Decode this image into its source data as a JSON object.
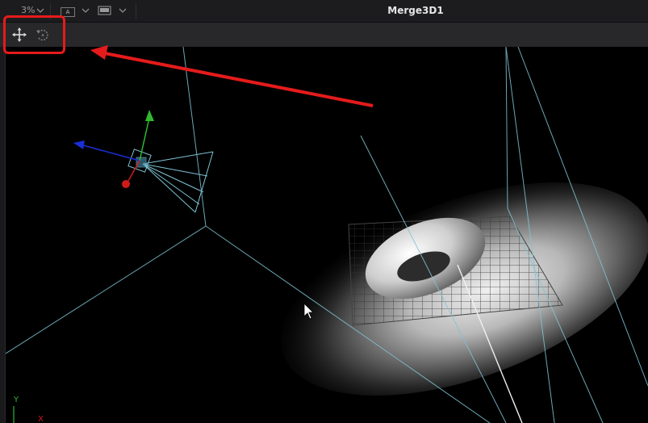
{
  "header": {
    "zoom_label": "3%",
    "view_a_label": "A",
    "title": "Merge3D1"
  },
  "toolbar": {
    "tools": [
      {
        "icon": "move-transform-icon"
      },
      {
        "icon": "rotate-icon"
      }
    ]
  },
  "viewport": {
    "axis_labels": {
      "y": "Y",
      "x": "X"
    }
  },
  "colors": {
    "annotation": "#e51b1b",
    "wireframe": "#7fc4d6",
    "axis_x": "#d21a1a",
    "axis_y": "#2fb82f",
    "axis_z": "#1a2fd6"
  }
}
